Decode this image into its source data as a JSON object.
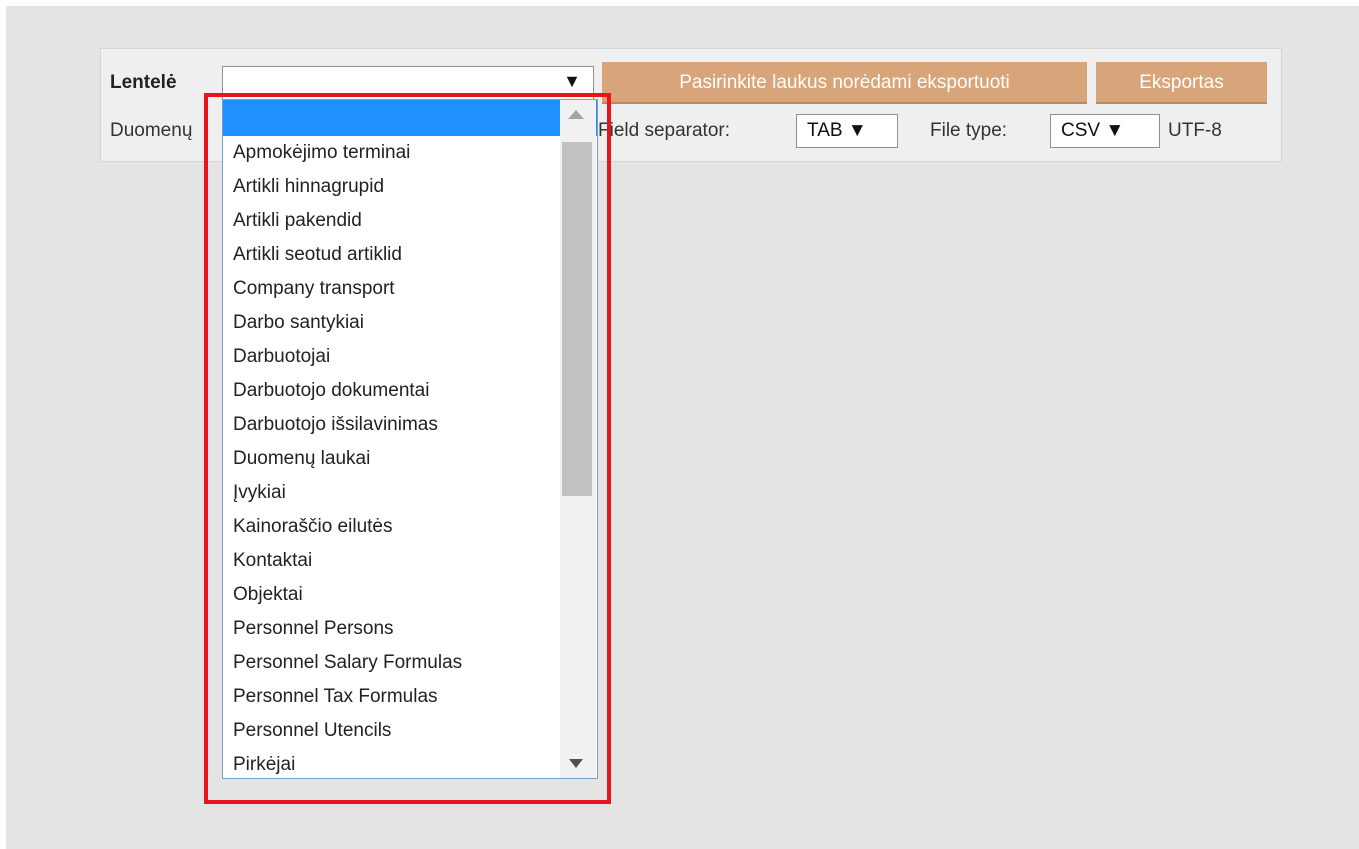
{
  "form": {
    "table_label": "Lentelė",
    "data_label_visible": "Duomenų",
    "select_fields_button": "Pasirinkite laukus norėdami eksportuoti",
    "export_button": "Eksportas",
    "field_separator_label": "Field separator:",
    "field_separator_value": "TAB ▼",
    "file_type_label": "File type:",
    "file_type_value": "CSV ▼",
    "encoding": "UTF-8",
    "select_arrow": "▼"
  },
  "dropdown": {
    "options": [
      "",
      "Apmokėjimo terminai",
      "Artikli hinnagrupid",
      "Artikli pakendid",
      "Artikli seotud artiklid",
      "Company transport",
      "Darbo santykiai",
      "Darbuotojai",
      "Darbuotojo dokumentai",
      "Darbuotojo išsilavinimas",
      "Duomenų laukai",
      "Įvykiai",
      "Kainoraščio eilutės",
      "Kontaktai",
      "Objektai",
      "Personnel Persons",
      "Personnel Salary Formulas",
      "Personnel Tax Formulas",
      "Personnel Utencils",
      "Pirkėjai"
    ]
  },
  "colors": {
    "button": "#d8a47a",
    "selected_option": "#1e90ff",
    "highlight": "#e8141e"
  }
}
